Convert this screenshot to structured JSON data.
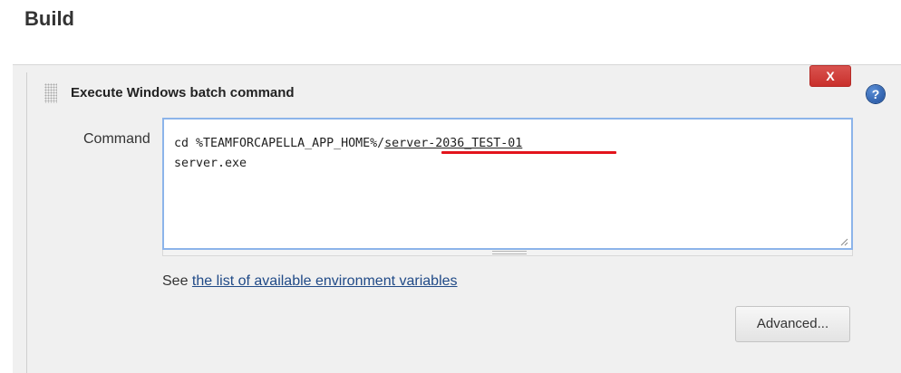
{
  "section": {
    "title": "Build"
  },
  "build_step": {
    "title": "Execute Windows batch command",
    "delete_label": "X",
    "help_icon": "question-icon",
    "help_label": "?",
    "command": {
      "label": "Command",
      "line1_prefix": "cd %TEAMFORCAPELLA_APP_HOME%/",
      "line1_target": "server-2036_TEST-01",
      "line2": "server.exe"
    },
    "env_help": {
      "prefix": "See ",
      "link_text": "the list of available environment variables"
    },
    "advanced_label": "Advanced..."
  },
  "colors": {
    "delete_button": "#d9534f",
    "help_icon": "#2b5fad",
    "annotation": "#e3141c",
    "textarea_focus_border": "#8cb4ea",
    "link": "#204a87"
  }
}
